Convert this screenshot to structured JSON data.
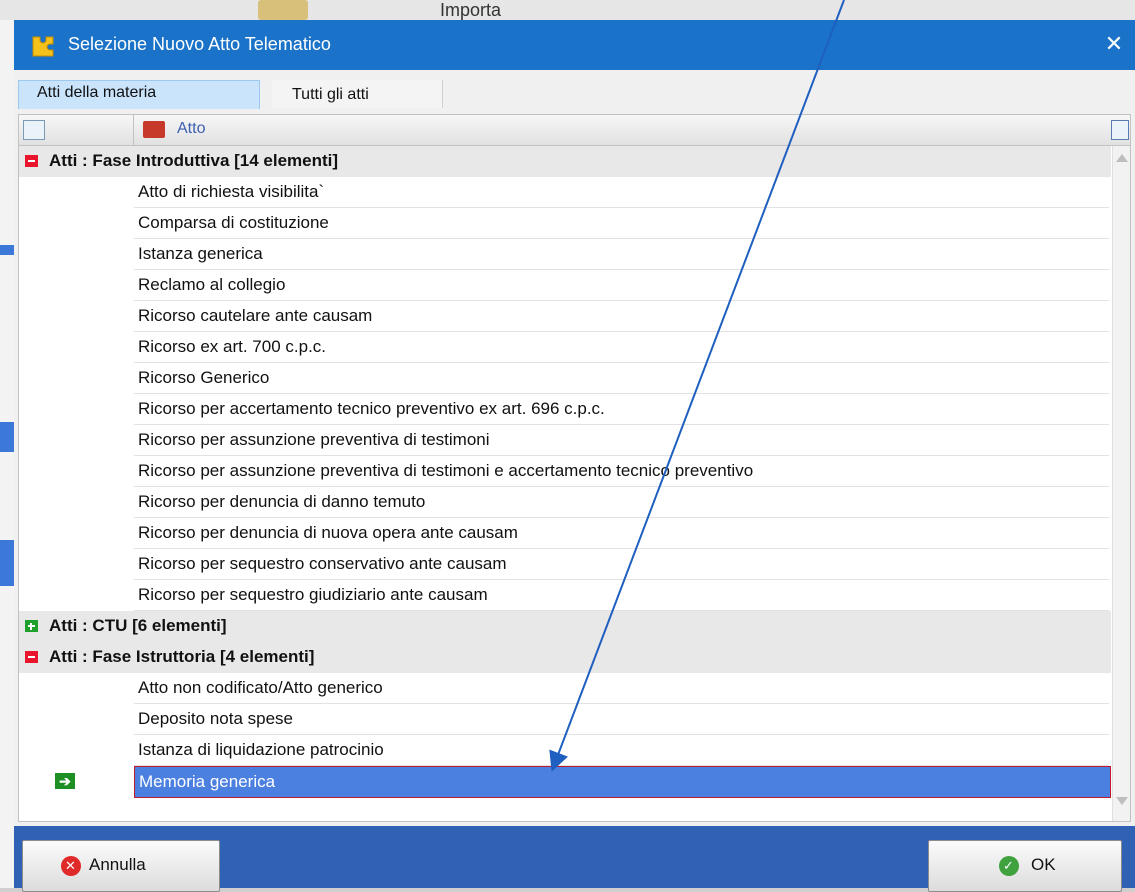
{
  "background_app": {
    "top_text": "Importa"
  },
  "dialog": {
    "title": "Selezione Nuovo Atto Telematico",
    "close_glyph": "✕"
  },
  "tabs": [
    {
      "label": "Atti della materia",
      "active": true
    },
    {
      "label": "Tutti gli atti",
      "active": false
    }
  ],
  "grid": {
    "column_header": "Atto",
    "groups": [
      {
        "label": "Atti : Fase Introduttiva  [14 elementi]",
        "expanded": true,
        "items": [
          "Atto di richiesta visibilita`",
          "Comparsa di costituzione",
          "Istanza generica",
          "Reclamo al collegio",
          "Ricorso cautelare ante causam",
          "Ricorso ex art. 700 c.p.c.",
          "Ricorso Generico",
          "Ricorso per accertamento tecnico preventivo ex art. 696 c.p.c.",
          "Ricorso per assunzione preventiva di testimoni",
          "Ricorso per assunzione preventiva di testimoni e accertamento tecnico preventivo",
          "Ricorso per denuncia di danno temuto",
          "Ricorso per denuncia di nuova opera ante causam",
          "Ricorso per sequestro conservativo ante causam",
          "Ricorso per sequestro giudiziario ante causam"
        ]
      },
      {
        "label": "Atti : CTU  [6 elementi]",
        "expanded": false,
        "items": []
      },
      {
        "label": "Atti : Fase Istruttoria  [4 elementi]",
        "expanded": true,
        "items": [
          "Atto non codificato/Atto generico",
          "Deposito nota spese",
          "Istanza di liquidazione patrocinio",
          "Memoria generica"
        ]
      }
    ],
    "selected_item": "Memoria generica",
    "selected_marker": "➔"
  },
  "footer": {
    "cancel_label": "Annulla",
    "ok_label": "OK"
  },
  "colors": {
    "titlebar": "#1a73c8",
    "footer": "#2f62b5",
    "selection": "#4b7fe0",
    "annotation_arrow": "#1f5fbf"
  }
}
